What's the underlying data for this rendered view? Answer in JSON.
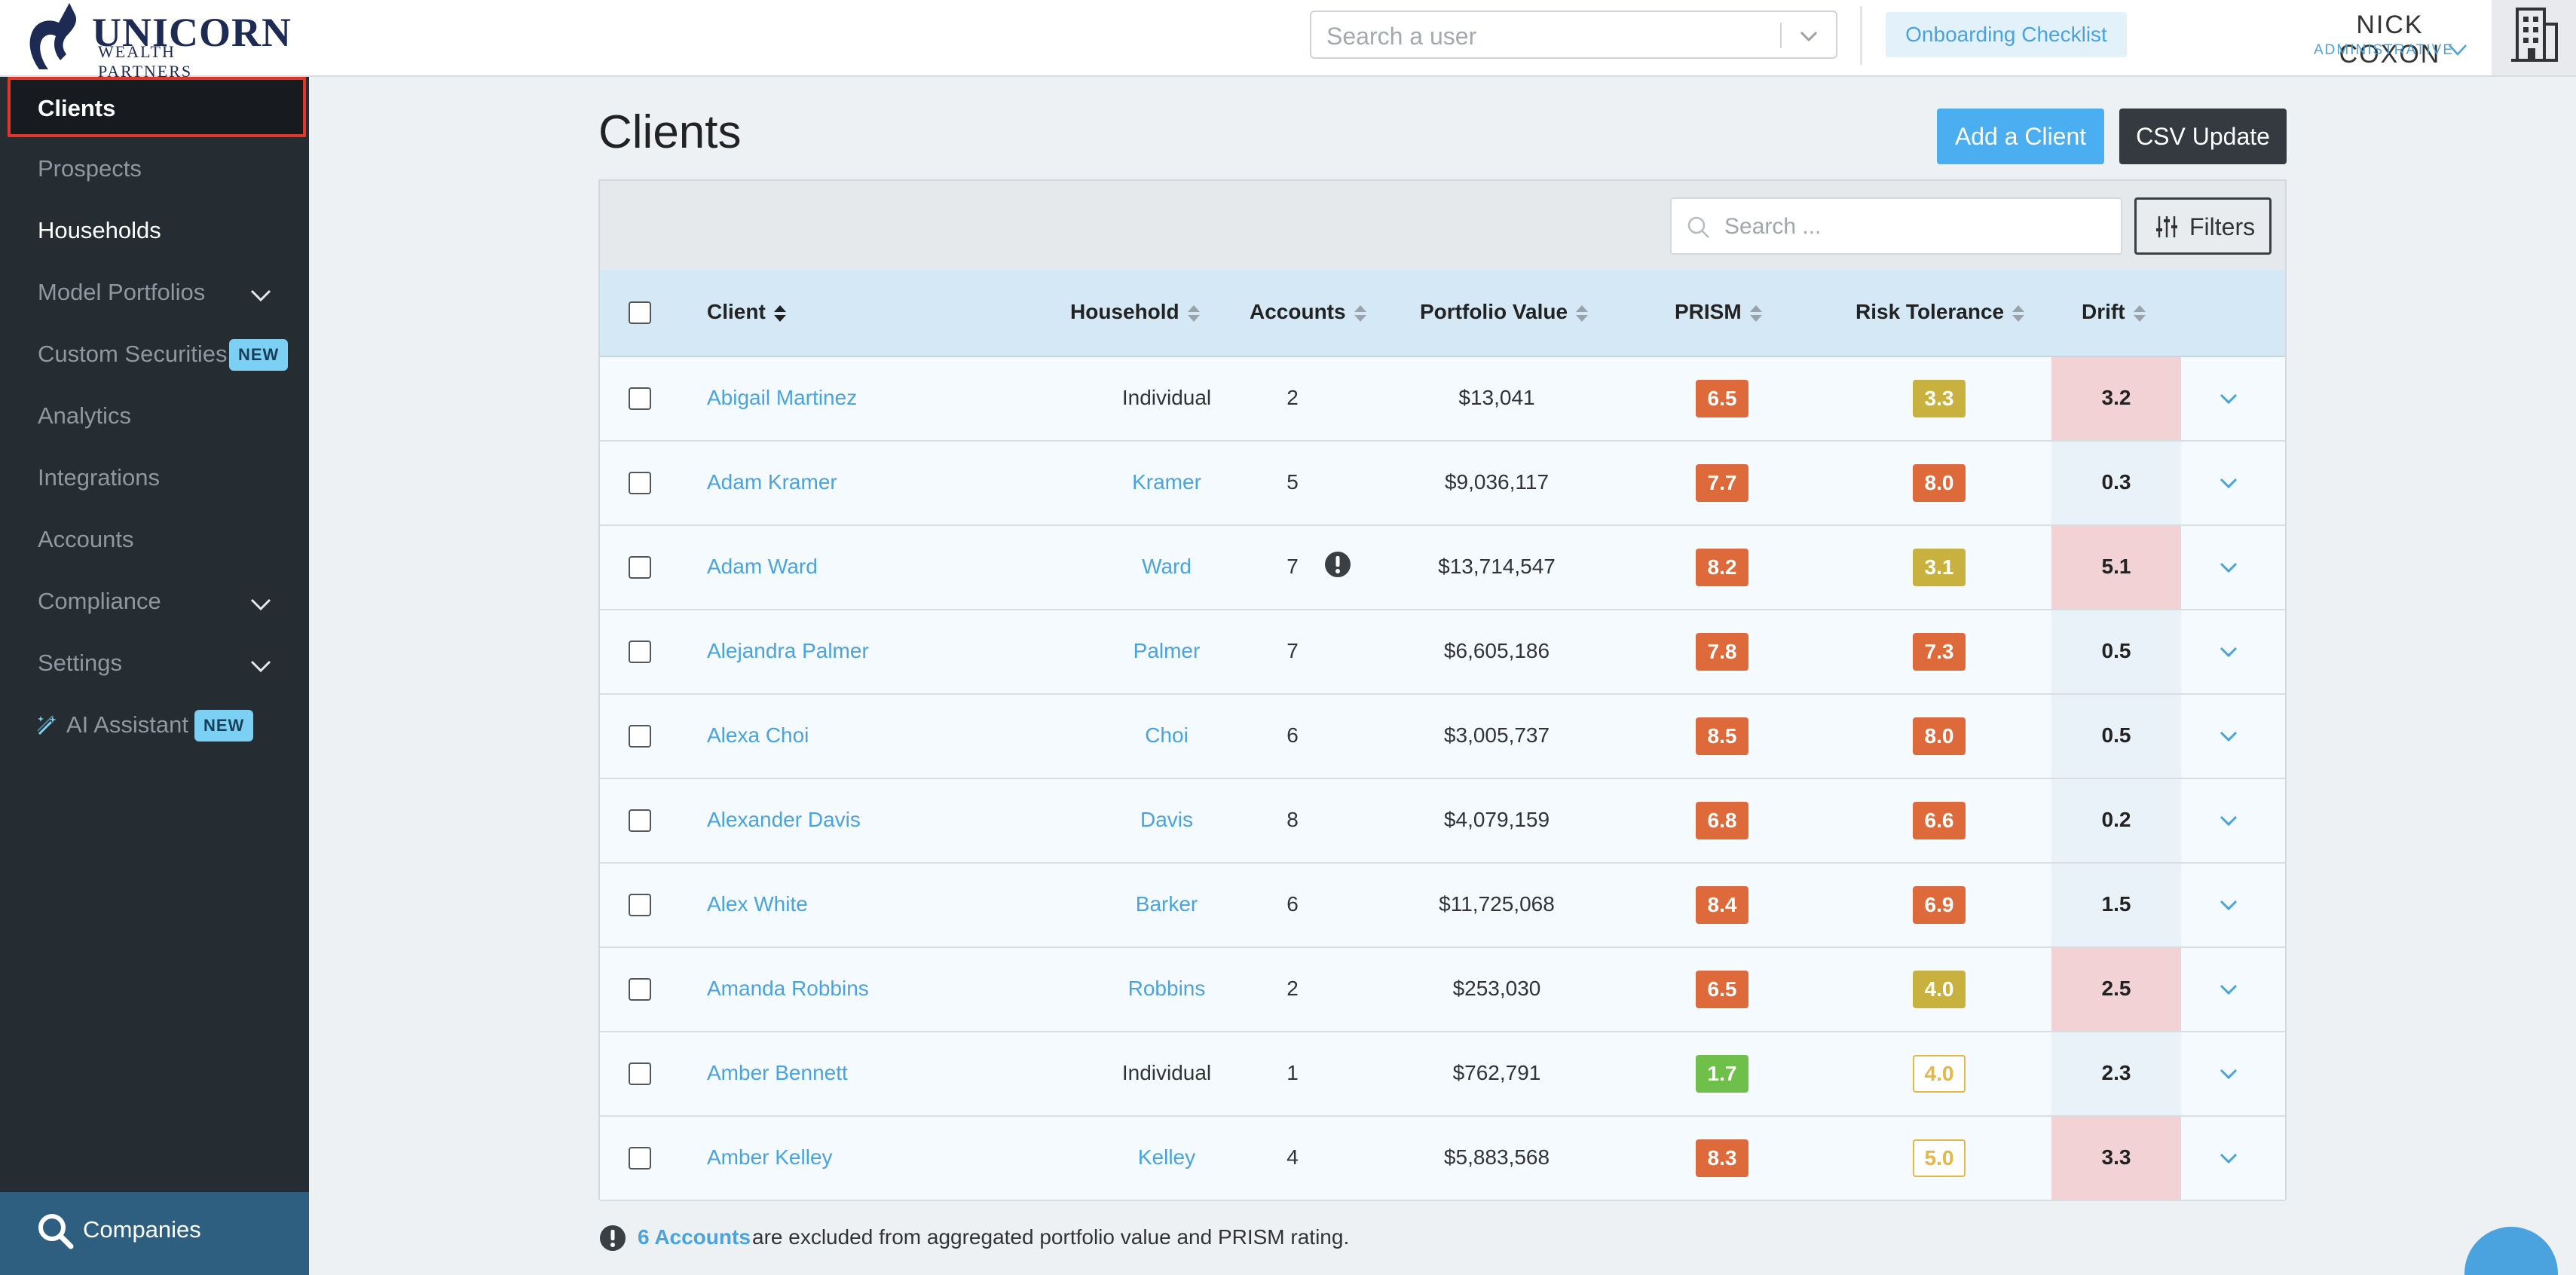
{
  "brand": {
    "name": "UNICORN",
    "tagline": "WEALTH PARTNERS"
  },
  "header": {
    "user_search_placeholder": "Search a user",
    "onboarding_label": "Onboarding Checklist",
    "user_name": "NICK COXON",
    "user_role": "ADMINISTRATIVE",
    "icons": {
      "user_search_chevron": "chevron-down-icon",
      "user_menu": "chevron-down-icon",
      "companies": "building-icon"
    }
  },
  "sidebar": {
    "items": [
      {
        "label": "Clients",
        "active": true
      },
      {
        "label": "Prospects"
      },
      {
        "label": "Households"
      },
      {
        "label": "Model Portfolios",
        "expandable": true
      },
      {
        "label": "Custom Securities",
        "badge": "NEW"
      },
      {
        "label": "Analytics"
      },
      {
        "label": "Integrations"
      },
      {
        "label": "Accounts"
      },
      {
        "label": "Compliance",
        "expandable": true
      },
      {
        "label": "Settings",
        "expandable": true
      },
      {
        "label": "AI Assistant",
        "badge": "NEW",
        "icon": "magic-wand-icon"
      }
    ],
    "bottom": {
      "label": "Companies",
      "icon": "search-icon"
    }
  },
  "main": {
    "title": "Clients",
    "add_button": "Add a Client",
    "csv_button": "CSV Update",
    "search_placeholder": "Search ...",
    "filters_label": "Filters",
    "columns": [
      "Client",
      "Household",
      "Accounts",
      "Portfolio Value",
      "PRISM",
      "Risk Tolerance",
      "Drift"
    ],
    "rows": [
      {
        "client": "Abigail Martinez",
        "household": "Individual",
        "household_link": false,
        "accounts": "2",
        "portfolio": "$13,041",
        "prism": "6.5",
        "risk": "3.3",
        "drift": "3.2",
        "drift_high": true
      },
      {
        "client": "Adam Kramer",
        "household": "Kramer",
        "household_link": true,
        "accounts": "5",
        "portfolio": "$9,036,117",
        "prism": "7.7",
        "risk": "8.0",
        "drift": "0.3",
        "drift_high": false
      },
      {
        "client": "Adam Ward",
        "household": "Ward",
        "household_link": true,
        "accounts": "7",
        "portfolio": "$13,714,547",
        "prism": "8.2",
        "risk": "3.1",
        "drift": "5.1",
        "drift_high": true,
        "warning": true
      },
      {
        "client": "Alejandra Palmer",
        "household": "Palmer",
        "household_link": true,
        "accounts": "7",
        "portfolio": "$6,605,186",
        "prism": "7.8",
        "risk": "7.3",
        "drift": "0.5",
        "drift_high": false
      },
      {
        "client": "Alexa Choi",
        "household": "Choi",
        "household_link": true,
        "accounts": "6",
        "portfolio": "$3,005,737",
        "prism": "8.5",
        "risk": "8.0",
        "drift": "0.5",
        "drift_high": false
      },
      {
        "client": "Alexander Davis",
        "household": "Davis",
        "household_link": true,
        "accounts": "8",
        "portfolio": "$4,079,159",
        "prism": "6.8",
        "risk": "6.6",
        "drift": "0.2",
        "drift_high": false
      },
      {
        "client": "Alex White",
        "household": "Barker",
        "household_link": true,
        "accounts": "6",
        "portfolio": "$11,725,068",
        "prism": "8.4",
        "risk": "6.9",
        "drift": "1.5",
        "drift_high": false
      },
      {
        "client": "Amanda Robbins",
        "household": "Robbins",
        "household_link": true,
        "accounts": "2",
        "portfolio": "$253,030",
        "prism": "6.5",
        "risk": "4.0",
        "drift": "2.5",
        "drift_high": true
      },
      {
        "client": "Amber Bennett",
        "household": "Individual",
        "household_link": false,
        "accounts": "1",
        "portfolio": "$762,791",
        "prism": "1.7",
        "risk": "4.0",
        "risk_outline": true,
        "drift": "2.3",
        "drift_high": false
      },
      {
        "client": "Amber Kelley",
        "household": "Kelley",
        "household_link": true,
        "accounts": "4",
        "portfolio": "$5,883,568",
        "prism": "8.3",
        "risk": "5.0",
        "risk_outline": true,
        "drift": "3.3",
        "drift_high": true
      }
    ],
    "footer_link": "6 Accounts",
    "footer_text": "are excluded from aggregated portfolio value and PRISM rating."
  },
  "colors": {
    "accent": "#4aa3df",
    "prism_high": "#de6a3b",
    "prism_low": "#6fc04a",
    "risk_mid": "#c9b13f",
    "risk_high": "#de6a3b",
    "risk_outline": "#e7b744",
    "drift_high_bg": "#f2d2d4",
    "drift_low_bg": "#e9f2f9"
  }
}
